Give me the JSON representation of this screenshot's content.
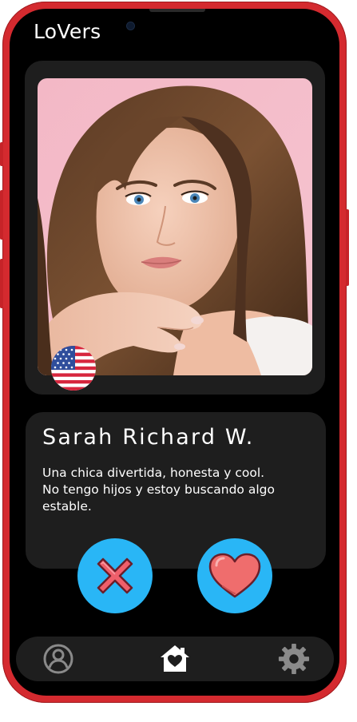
{
  "app": {
    "title": "LoVers"
  },
  "profile": {
    "name": "Sarah Richard W.",
    "bio_line1": "Una chica divertida, honesta y cool.",
    "bio_line2": "No tengo hijos y estoy buscando algo",
    "bio_line3": "estable.",
    "flag_icon": "us-flag-icon",
    "photo": "profile-photo"
  },
  "actions": {
    "dislike_icon": "close-x-icon",
    "like_icon": "heart-icon"
  },
  "nav": {
    "items": [
      {
        "icon": "user-icon",
        "active": false
      },
      {
        "icon": "home-heart-icon",
        "active": true
      },
      {
        "icon": "gear-icon",
        "active": false
      }
    ]
  },
  "colors": {
    "phone_frame": "#d42a2f",
    "screen_background": "#000000",
    "card_background": "#1e1e1e",
    "action_button": "#29b6f6",
    "dislike_x": "#ef5f6b",
    "like_heart": "#ef6d6d",
    "nav_inactive": "#8a8a8a",
    "nav_active": "#ffffff"
  }
}
